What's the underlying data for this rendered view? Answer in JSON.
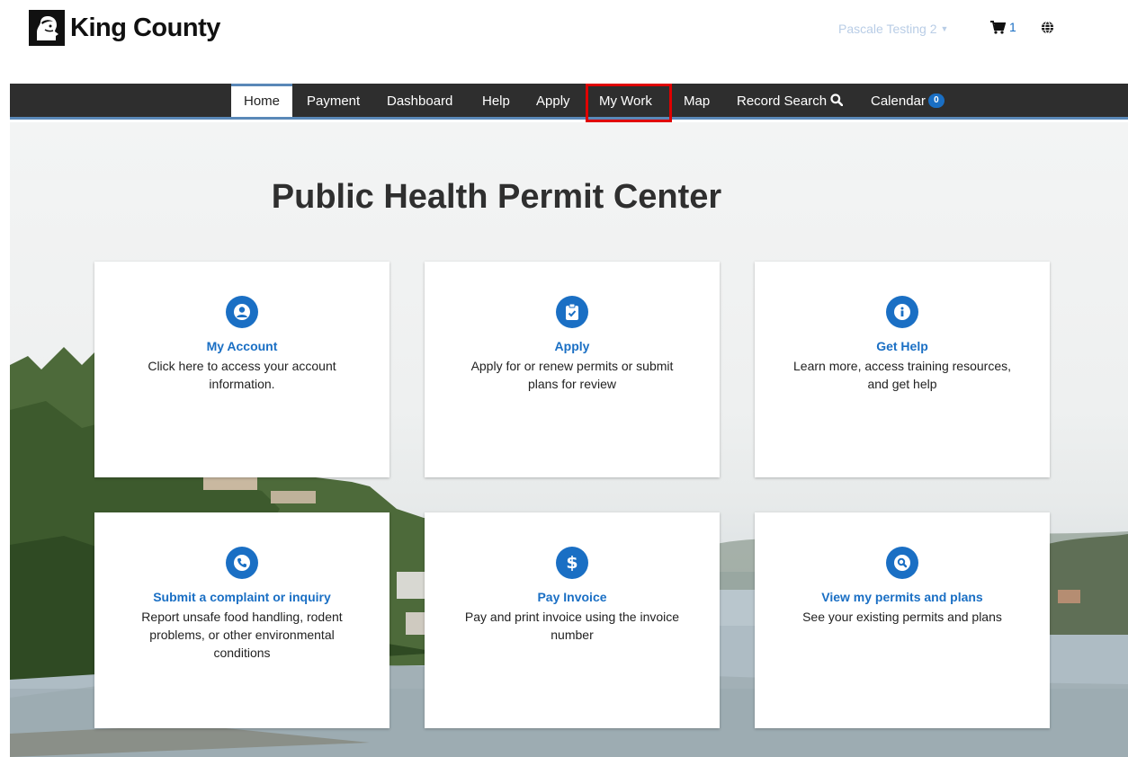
{
  "header": {
    "logo_text": "King County",
    "user_name": "Pascale Testing 2",
    "cart_count": "1"
  },
  "nav": {
    "items": [
      {
        "label": "Home",
        "active": true
      },
      {
        "label": "Payment"
      },
      {
        "label": "Dashboard"
      },
      {
        "label": "Help"
      },
      {
        "label": "Apply"
      },
      {
        "label": "My Work",
        "highlighted": true
      },
      {
        "label": "Map"
      },
      {
        "label": "Record Search"
      },
      {
        "label": "Calendar",
        "badge": "0"
      }
    ]
  },
  "main": {
    "title": "Public Health Permit Center",
    "cards": [
      {
        "icon": "user-icon",
        "title": "My Account",
        "desc": "Click here to access your account information."
      },
      {
        "icon": "clipboard-check-icon",
        "title": "Apply",
        "desc": "Apply for or renew permits or submit plans for review"
      },
      {
        "icon": "info-icon",
        "title": "Get Help",
        "desc": "Learn more, access training resources, and get help"
      },
      {
        "icon": "phone-icon",
        "title": "Submit a complaint or inquiry",
        "desc": "Report unsafe food handling, rodent problems, or other environmental conditions"
      },
      {
        "icon": "dollar-icon",
        "title": "Pay Invoice",
        "desc": "Pay and print invoice using the invoice number"
      },
      {
        "icon": "search-icon",
        "title": "View my permits and plans",
        "desc": "See your existing permits and plans"
      }
    ]
  },
  "colors": {
    "accent": "#1a6fc4",
    "nav_bg": "#2e2e2e",
    "highlight_box": "#e00000"
  }
}
